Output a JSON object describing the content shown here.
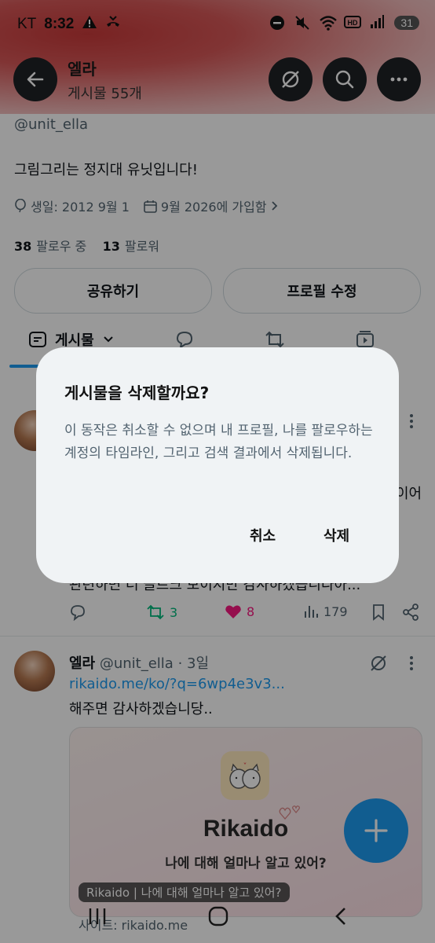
{
  "status_bar": {
    "carrier": "KT",
    "time": "8:32",
    "battery": "31"
  },
  "header": {
    "name": "엘라",
    "post_count": "게시물 55개"
  },
  "profile": {
    "handle": "@unit_ella",
    "bio": "그림그리는 정지대 유닛입니다!",
    "birthday": "생일: 2012 9월 1",
    "joined": "9월 2026에 가입함",
    "following_count": "38",
    "following_label": "팔로우 중",
    "followers_count": "13",
    "followers_label": "팔로워",
    "share_button": "공유하기",
    "edit_button": "프로필 수정"
  },
  "tabs": {
    "posts_label": "게시물"
  },
  "post1": {
    "text_fragment": "이어",
    "truncated_line": "관련하면 더 글르크 보이지만 감사하겠습니다아...",
    "retweets": "3",
    "likes": "8",
    "views": "179"
  },
  "post2": {
    "name": "엘라",
    "handle_time": "@unit_ella · 3일",
    "link": "rikaido.me/ko/?q=6wp4e3v3...",
    "text": "해주면 감사하겠습니당..",
    "card": {
      "name": "Rikaido",
      "tagline": "나에 대해 얼마나 알고 있어?",
      "caption": "Rikaido | 나에 대해 얼마나 알고 있어?",
      "domain": "사이트: rikaido.me"
    }
  },
  "dialog": {
    "title": "게시물을 삭제할까요?",
    "body": "이 동작은 취소할 수 없으며 내 프로필, 나를 팔로우하는 계정의 타임라인, 그리고 검색 결과에서 삭제됩니다.",
    "cancel": "취소",
    "delete": "삭제"
  },
  "colors": {
    "accent": "#1d9bf0",
    "like": "#f91880",
    "retweet": "#00ba7c"
  }
}
